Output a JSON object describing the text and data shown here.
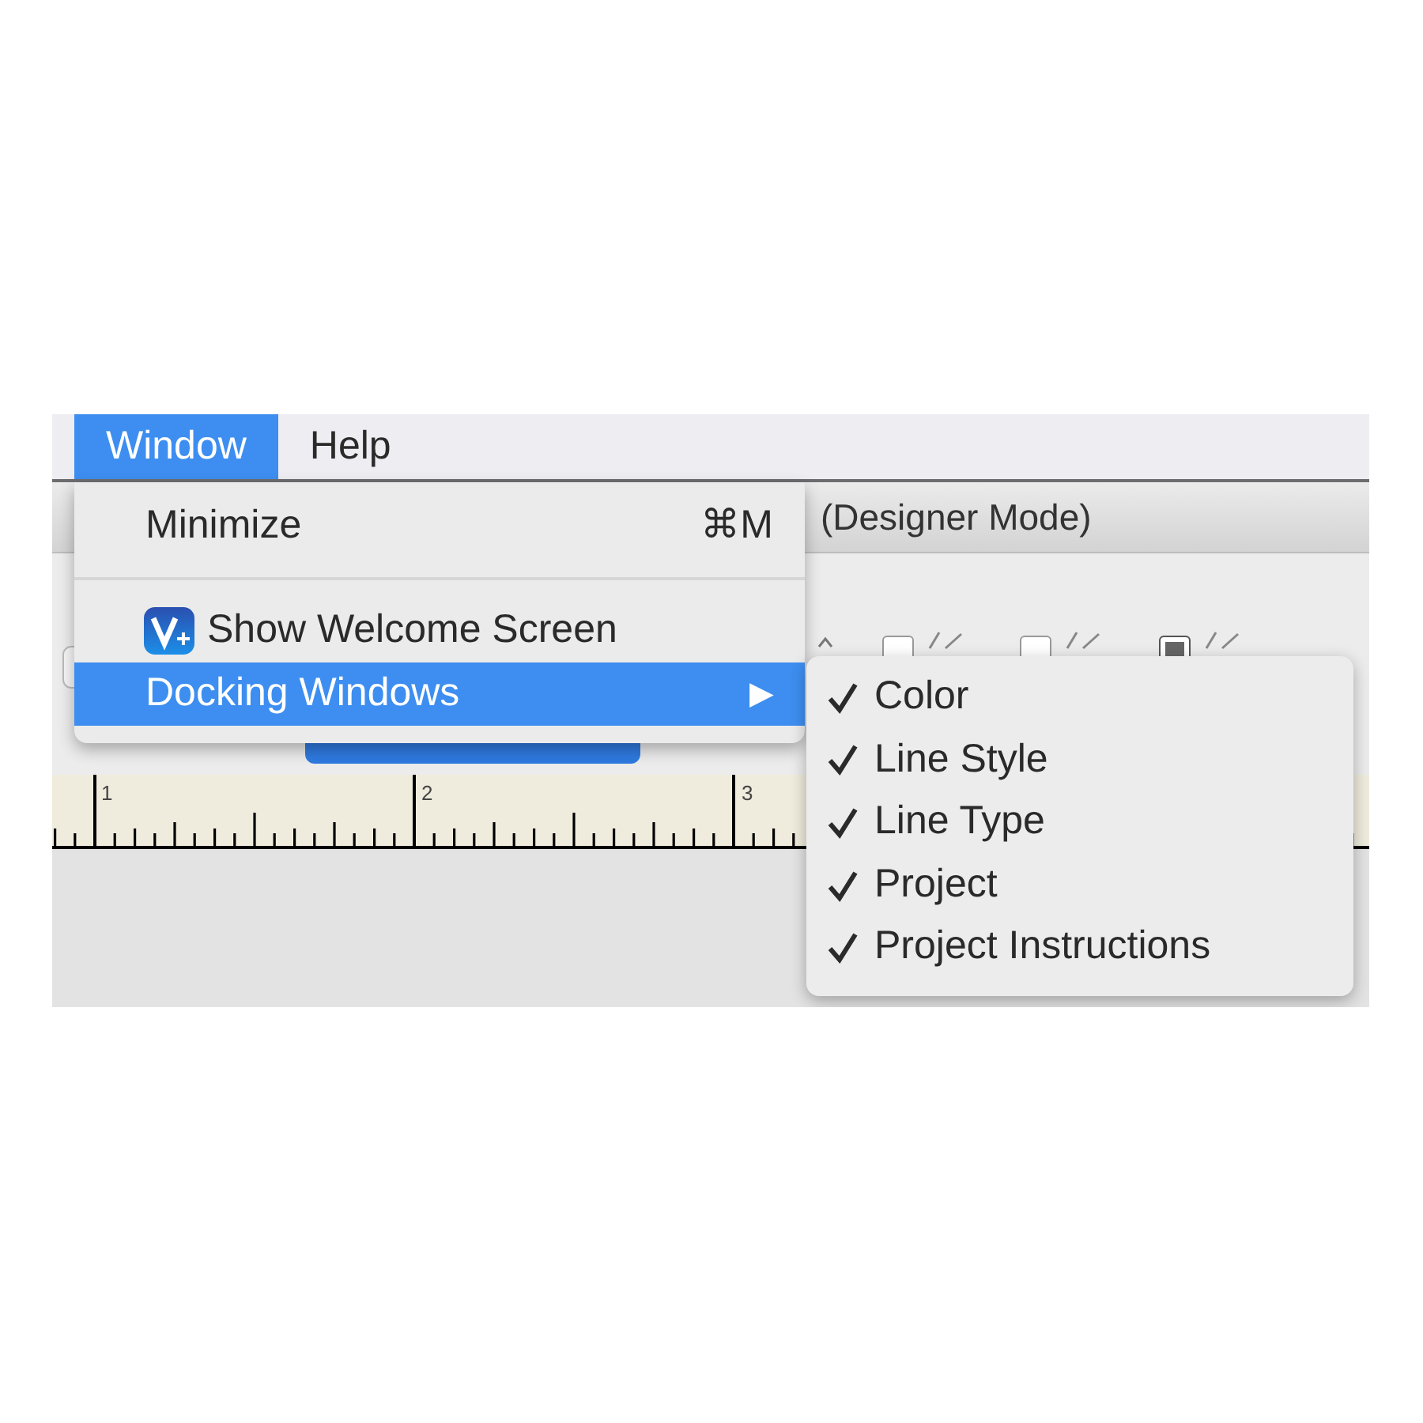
{
  "menu_bar": {
    "items": [
      {
        "label": "Window",
        "selected": true
      },
      {
        "label": "Help",
        "selected": false
      }
    ]
  },
  "window": {
    "title": "(Designer Mode)"
  },
  "toolbar": {
    "checkboxes": [
      {
        "checked": false
      },
      {
        "checked": false
      },
      {
        "checked": true
      }
    ]
  },
  "ruler": {
    "labels": [
      "1",
      "2",
      "3"
    ]
  },
  "menu": {
    "items": [
      {
        "kind": "item",
        "label": "Minimize",
        "shortcut": "⌘M",
        "selected": false
      },
      {
        "kind": "separator"
      },
      {
        "kind": "icon-item",
        "label": "Show Welcome Screen",
        "selected": false
      },
      {
        "kind": "submenu",
        "label": "Docking Windows",
        "arrow": "▶",
        "selected": true
      }
    ]
  },
  "submenu": {
    "items": [
      {
        "label": "Color",
        "checked": true
      },
      {
        "label": "Line Style",
        "checked": true
      },
      {
        "label": "Line Type",
        "checked": true
      },
      {
        "label": "Project",
        "checked": true
      },
      {
        "label": "Project Instructions",
        "checked": true
      }
    ]
  }
}
